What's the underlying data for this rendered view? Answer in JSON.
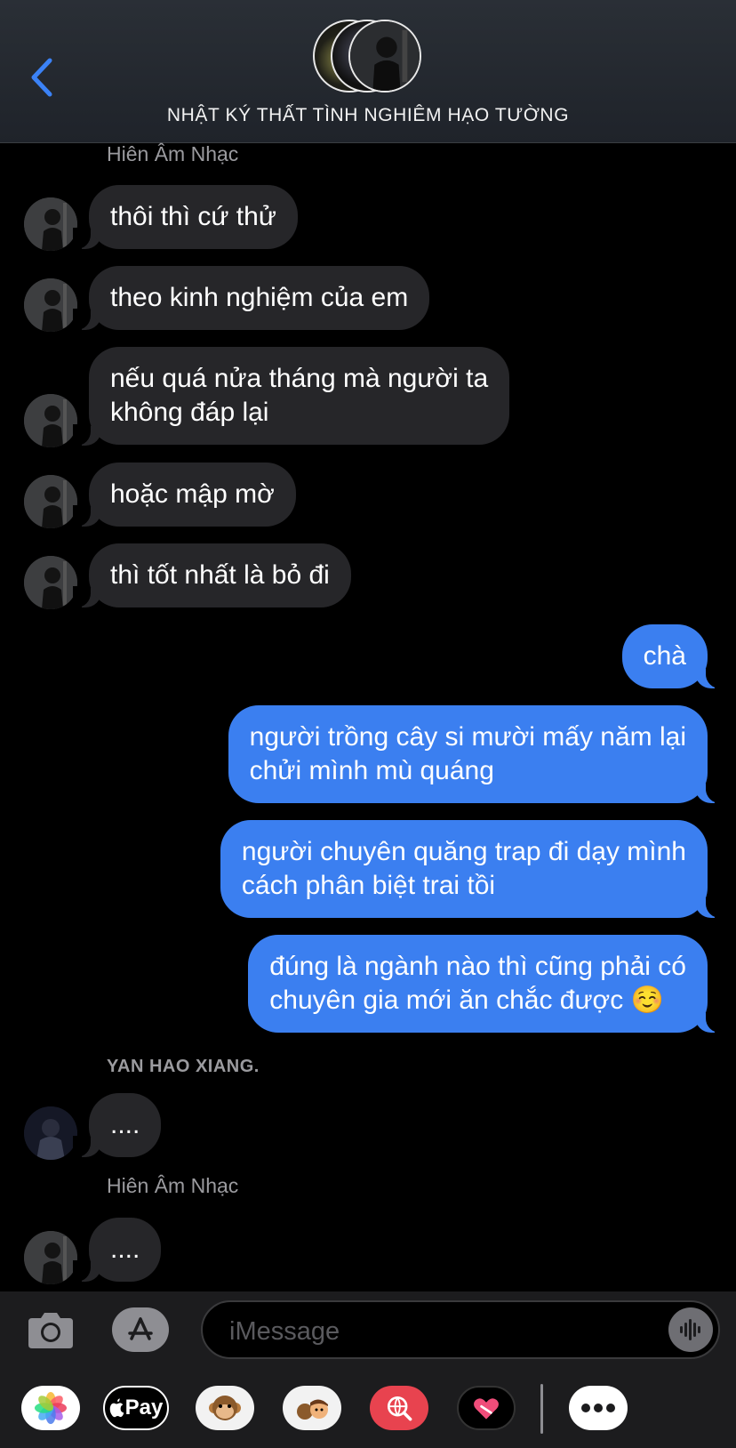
{
  "header": {
    "title": "NHẬT KÝ THẤT TÌNH NGHIÊM HẠO TƯỜNG"
  },
  "messages": {
    "sender1": "Hiên Âm Nhạc",
    "in1": "thôi thì cứ thử",
    "in2": "theo kinh nghiệm của em",
    "in3": "nếu quá nửa tháng mà người ta\nkhông đáp lại",
    "in4": "hoặc mập mờ",
    "in5": "thì tốt nhất là bỏ đi",
    "out1": "chà",
    "out2": "người trồng cây si mười mấy năm lại\nchửi mình mù quáng",
    "out3": "người chuyên quăng trap đi dạy mình\ncách phân biệt trai tồi",
    "out4": "đúng là ngành nào thì cũng phải có\nchuyên gia mới ăn chắc được ☺️",
    "sender2": "YAN HAO XIANG.",
    "in6": "....",
    "sender3": "Hiên Âm Nhạc",
    "in7": "...."
  },
  "input": {
    "placeholder": "iMessage"
  },
  "app_strip": {
    "pay_label": "Pay",
    "photos_icon": "photos-icon",
    "memoji_icon": "monkey-icon",
    "more_label": "•••"
  },
  "colors": {
    "outgoing_bubble": "#3b7ff0",
    "incoming_bubble": "#262629",
    "accent": "#3b7ff0"
  }
}
